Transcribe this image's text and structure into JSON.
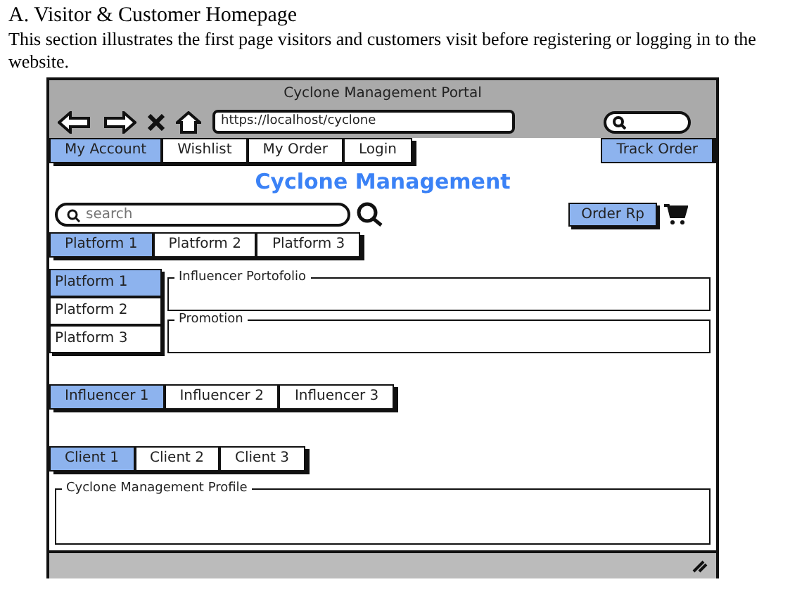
{
  "document": {
    "marker": "A.",
    "heading": "Visitor & Customer Homepage",
    "paragraph": "This section illustrates the first page visitors and customers visit before registering or logging in to the website."
  },
  "window": {
    "title": "Cyclone Management Portal",
    "url": "https://localhost/cyclone"
  },
  "nav": [
    {
      "label": "My Account",
      "selected": true
    },
    {
      "label": "Wishlist",
      "selected": false
    },
    {
      "label": "My Order",
      "selected": false
    },
    {
      "label": "Login",
      "selected": false
    }
  ],
  "track_order": "Track Order",
  "brand": "Cyclone Management",
  "search": {
    "placeholder": "search"
  },
  "order_button": "Order Rp",
  "platform_tabs": [
    {
      "label": "Platform 1",
      "selected": true
    },
    {
      "label": "Platform 2",
      "selected": false
    },
    {
      "label": "Platform 3",
      "selected": false
    }
  ],
  "platform_list": [
    {
      "label": "Platform 1",
      "selected": true
    },
    {
      "label": "Platform 2",
      "selected": false
    },
    {
      "label": "Platform 3",
      "selected": false
    }
  ],
  "sections": [
    "Influencer Portofolio",
    "Promotion"
  ],
  "influencer_tabs": [
    {
      "label": "Influencer 1",
      "selected": true
    },
    {
      "label": "Influencer 2",
      "selected": false
    },
    {
      "label": "Influencer 3",
      "selected": false
    }
  ],
  "client_tabs": [
    {
      "label": "Client 1",
      "selected": true
    },
    {
      "label": "Client 2",
      "selected": false
    },
    {
      "label": "Client 3",
      "selected": false
    }
  ],
  "profile": "Cyclone Management Profile"
}
